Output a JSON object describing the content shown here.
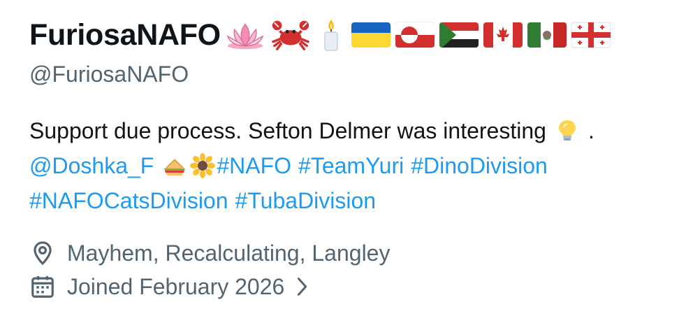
{
  "profile": {
    "display_name": "FuriosaNAFO",
    "name_emojis": [
      "lotus-icon",
      "crab-icon",
      "candle-icon",
      "flag-ukraine-icon",
      "flag-greenland-icon",
      "flag-sudan-icon",
      "flag-canada-icon",
      "flag-mexico-icon",
      "flag-georgia-icon"
    ],
    "handle": "@FuriosaNAFO",
    "bio": {
      "text_line1": "Support due process. Sefton Delmer was interesting",
      "line1_end": ".",
      "mention": "@Doshka_F",
      "hashtag_nafo": "#NAFO",
      "hashtag_teamyuri": "#TeamYuri",
      "hashtag_dinodivision": "#DinoDivision",
      "hashtag_catsdivision": "#NAFOCatsDivision",
      "hashtag_tubadivision": "#TubaDivision"
    },
    "location": "Mayhem, Recalculating, Langley",
    "joined": "Joined February 2026"
  },
  "colors": {
    "text_primary": "#0f1419",
    "text_secondary": "#536471",
    "link": "#1d9bf0"
  }
}
